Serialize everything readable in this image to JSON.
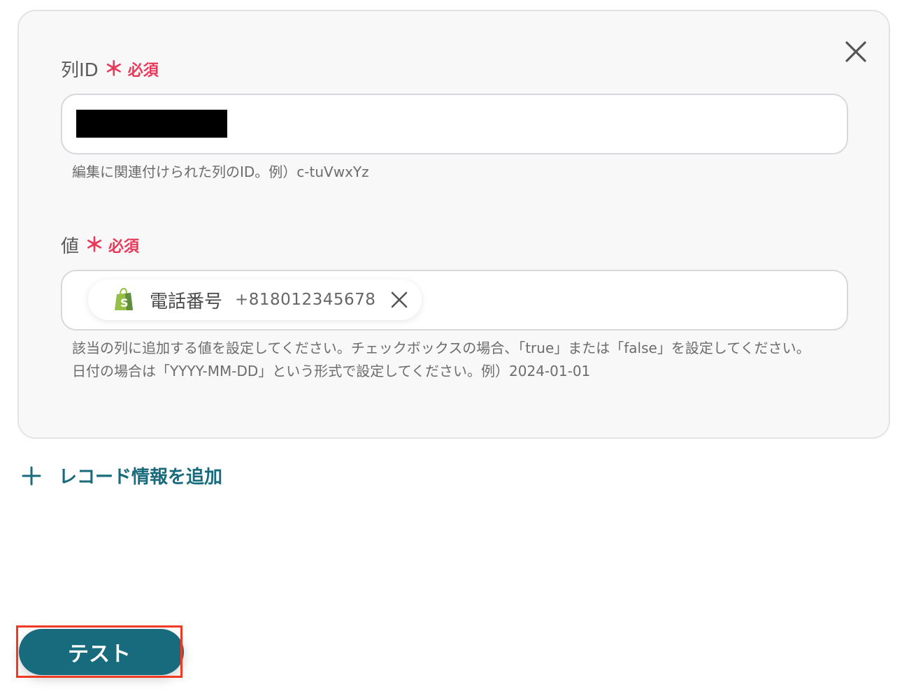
{
  "card": {
    "column_id": {
      "label": "列ID",
      "required_mark": "＊",
      "required_text": "必須",
      "value_redacted": true,
      "hint": "編集に関連付けられた列のID。例）c-tuVwxYz"
    },
    "value": {
      "label": "値",
      "required_mark": "＊",
      "required_text": "必須",
      "chip": {
        "icon": "shopify-bag-icon",
        "label": "電話番号",
        "value": "+818012345678"
      },
      "hint_line1": "該当の列に追加する値を設定してください。チェックボックスの場合、「true」または「false」を設定してください。",
      "hint_line2": "日付の場合は「YYYY-MM-DD」という形式で設定してください。例）2024-01-01"
    }
  },
  "add_record_label": "レコード情報を追加",
  "test_button_label": "テスト",
  "colors": {
    "accent": "#176b7d",
    "required": "#e8395a",
    "highlight": "#ee3a22",
    "shopify_green": "#95bf47"
  }
}
